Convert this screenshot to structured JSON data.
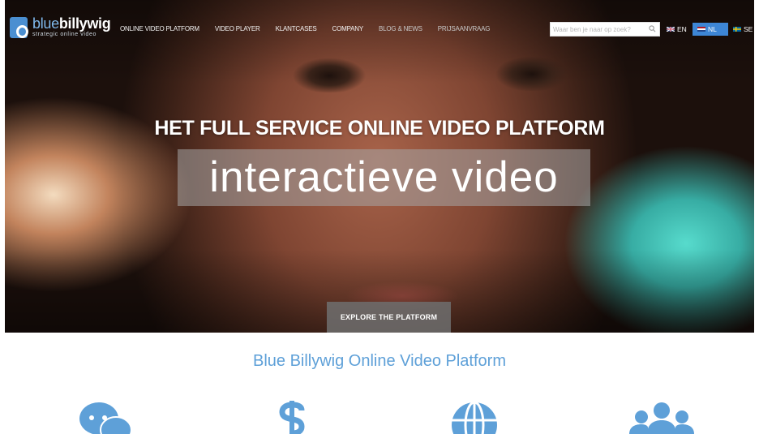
{
  "brand": {
    "name_light": "blue",
    "name_bold": "billywig",
    "tagline": "strategic online video"
  },
  "nav": {
    "items": [
      {
        "label": "ONLINE VIDEO PLATFORM"
      },
      {
        "label": "VIDEO PLAYER"
      },
      {
        "label": "KLANTCASES"
      },
      {
        "label": "COMPANY"
      },
      {
        "label": "BLOG & NEWS"
      },
      {
        "label": "PRIJSAANVRAAG"
      }
    ],
    "search": {
      "placeholder": "Waar ben je naar op zoek?"
    },
    "languages": [
      {
        "code": "EN",
        "selected": false
      },
      {
        "code": "NL",
        "selected": true
      },
      {
        "code": "SE",
        "selected": false
      }
    ]
  },
  "hero": {
    "title": "HET FULL SERVICE ONLINE VIDEO PLATFORM",
    "rotating_word": "interactieve video",
    "cta_label": "EXPLORE THE PLATFORM"
  },
  "features": {
    "title": "Blue Billywig Online Video Platform",
    "icons": [
      "chat-bubbles-icon",
      "dollar-icon",
      "globe-icon",
      "users-group-icon"
    ]
  },
  "colors": {
    "accent": "#5ea0d8",
    "nl_highlight": "#3d86d6",
    "logo": "#4b8fd1"
  }
}
